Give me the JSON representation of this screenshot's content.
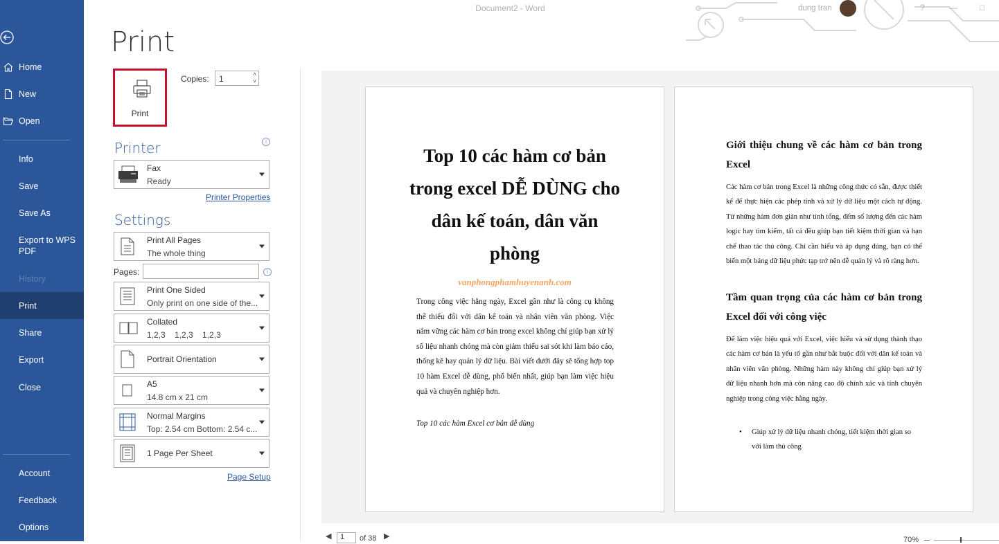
{
  "window": {
    "title": "Document2  -  Word",
    "user": "dung tran",
    "help": "?",
    "minimize": "—",
    "restore": "□"
  },
  "sidebar": {
    "items": [
      {
        "label": "Home",
        "icon": "home-icon"
      },
      {
        "label": "New",
        "icon": "new-doc-icon"
      },
      {
        "label": "Open",
        "icon": "open-folder-icon"
      },
      {
        "label": "Info"
      },
      {
        "label": "Save"
      },
      {
        "label": "Save As"
      },
      {
        "label": "Export to WPS PDF"
      },
      {
        "label": "History"
      },
      {
        "label": "Print"
      },
      {
        "label": "Share"
      },
      {
        "label": "Export"
      },
      {
        "label": "Close"
      },
      {
        "label": "Account"
      },
      {
        "label": "Feedback"
      },
      {
        "label": "Options"
      }
    ]
  },
  "print": {
    "heading": "Print",
    "button_label": "Print",
    "copies_label": "Copies:",
    "copies_value": "1"
  },
  "printer": {
    "heading": "Printer",
    "info": "i",
    "name": "Fax",
    "status": "Ready",
    "properties_link": "Printer Properties"
  },
  "settings": {
    "heading": "Settings",
    "range": {
      "title": "Print All Pages",
      "sub": "The whole thing"
    },
    "pages_label": "Pages:",
    "pages_value": "",
    "pages_info": "i",
    "sides": {
      "title": "Print One Sided",
      "sub": "Only print on one side of the..."
    },
    "collation": {
      "title": "Collated",
      "sub": "1,2,3    1,2,3    1,2,3"
    },
    "orientation": {
      "title": "Portrait Orientation"
    },
    "paper": {
      "title": "A5",
      "sub": "14.8 cm x 21 cm"
    },
    "margins": {
      "title": "Normal Margins",
      "sub": "Top: 2.54 cm Bottom: 2.54 c..."
    },
    "per_sheet": {
      "title": "1 Page Per Sheet"
    },
    "page_setup_link": "Page Setup"
  },
  "preview": {
    "page1": {
      "title": "Top 10 các hàm cơ bản trong excel DỄ DÙNG cho dân kế toán, dân văn phòng",
      "site": "vanphongphamhuyenanh.com",
      "paragraph": "Trong công việc hằng ngày, Excel gần như là công cụ không thể thiếu đối với dân kế toán và nhân viên văn phòng. Việc nắm vững các hàm cơ bản trong excel không chỉ giúp bạn xử lý số liệu nhanh chóng mà còn giảm thiểu sai sót khi làm báo cáo, thống kê hay quản lý dữ liệu. Bài viết dưới đây sẽ tổng hợp top 10 hàm Excel dễ dùng, phổ biến nhất, giúp bạn làm việc hiệu quả và chuyên nghiệp hơn.",
      "caption": "Top 10 các hàm Excel cơ bản dễ dùng"
    },
    "page2": {
      "heading1": "Giới thiệu chung về các hàm cơ bản trong Excel",
      "paragraph1": "Các hàm cơ bản trong Excel là những công thức có sẵn, được thiết kế để thực hiện các phép tính và xử lý dữ liệu một cách tự động. Từ những hàm đơn giản như tính tổng, đếm số lượng đến các hàm logic hay tìm kiếm, tất cả đều giúp bạn tiết kiệm thời gian và hạn chế thao tác thủ công. Chỉ cần hiểu và áp dụng đúng, bạn có thể biến một bảng dữ liệu phức tạp trở nên dễ quản lý và rõ ràng hơn.",
      "heading2": "Tầm quan trọng của các hàm cơ bản trong Excel đối với công việc",
      "paragraph2": "Để làm việc hiệu quả với Excel, việc hiểu và sử dụng thành thạo các hàm cơ bản là yếu tố gần như bắt buộc đối với dân kế toán và nhân viên văn phòng. Những hàm này không chỉ giúp bạn xử lý dữ liệu nhanh hơn mà còn nâng cao độ chính xác và tính chuyên nghiệp trong công việc hằng ngày.",
      "bullet1": "Giúp xử lý dữ liệu nhanh chóng, tiết kiệm thời gian so với làm thủ công"
    },
    "nav": {
      "current_page": "1",
      "of_label": "of 38"
    },
    "zoom": "70%"
  }
}
